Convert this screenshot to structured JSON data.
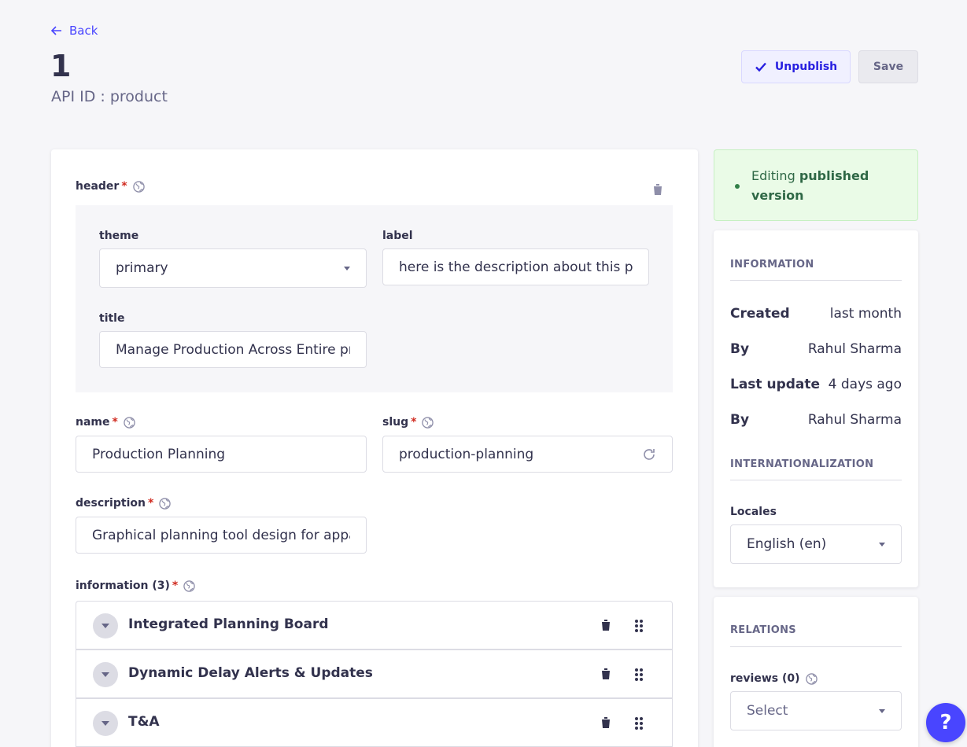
{
  "nav": {
    "back_label": "Back"
  },
  "page": {
    "title": "1",
    "api_id": "API ID : product"
  },
  "actions": {
    "unpublish_label": "Unpublish",
    "save_label": "Save"
  },
  "fields": {
    "header": {
      "label": "header",
      "required_mark": "*",
      "theme": {
        "label": "theme",
        "value": "primary"
      },
      "label_field": {
        "label": "label",
        "value": "here is the description about this proc"
      },
      "title": {
        "label": "title",
        "value": "Manage Production Across Entire proc"
      }
    },
    "name": {
      "label": "name",
      "required_mark": "*",
      "value": "Production Planning"
    },
    "slug": {
      "label": "slug",
      "required_mark": "*",
      "value": "production-planning"
    },
    "description": {
      "label": "description",
      "required_mark": "*",
      "value": "Graphical planning tool design for appare"
    },
    "information": {
      "label": "information (3)",
      "required_mark": "*",
      "items": [
        {
          "title": "Integrated Planning Board"
        },
        {
          "title": "Dynamic Delay Alerts & Updates"
        },
        {
          "title": "T&A"
        }
      ]
    }
  },
  "status": {
    "prefix": "Editing ",
    "emphasis": "published version"
  },
  "information_panel": {
    "heading": "INFORMATION",
    "rows": [
      {
        "key": "Created",
        "value": "last month"
      },
      {
        "key": "By",
        "value": "Rahul Sharma"
      },
      {
        "key": "Last update",
        "value": "4 days ago"
      },
      {
        "key": "By",
        "value": "Rahul Sharma"
      }
    ],
    "i18n_heading": "INTERNATIONALIZATION",
    "locales_label": "Locales",
    "locale_value": "English (en)"
  },
  "relations_panel": {
    "heading": "RELATIONS",
    "reviews_label": "reviews (0)",
    "select_placeholder": "Select"
  },
  "help": {
    "label": "?"
  },
  "colors": {
    "primary": "#4945ff",
    "success_bg": "#eafbe7",
    "danger": "#d02b20"
  }
}
